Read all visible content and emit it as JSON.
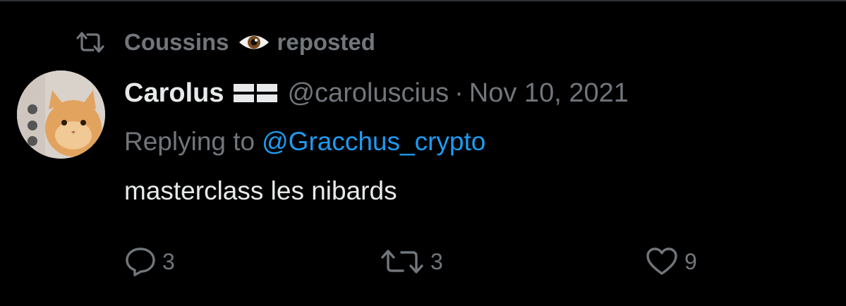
{
  "repost": {
    "user": "Coussins",
    "emoji_icon": "eye-emoji-icon",
    "action_text": "reposted"
  },
  "tweet": {
    "display_name": "Carolus",
    "flag_icon": "flag-icon",
    "handle": "@caroluscius",
    "separator": "·",
    "date": "Nov 10, 2021",
    "replying_prefix": "Replying to",
    "replying_to": "@Gracchus_crypto",
    "text": "masterclass les nibards"
  },
  "actions": {
    "reply_count": "3",
    "retweet_count": "3",
    "like_count": "9"
  },
  "colors": {
    "background": "#000000",
    "primary_text": "#e7e9ea",
    "secondary_text": "#71767b",
    "link": "#1d9bf0"
  }
}
